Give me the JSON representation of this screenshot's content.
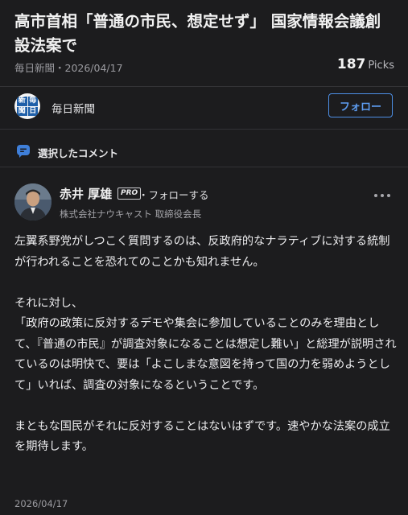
{
  "article": {
    "title": "高市首相「普通の市民、想定せず」 国家情報会議創設法案で",
    "source_date": "毎日新聞・2026/04/17",
    "picks_count": "187",
    "picks_label": "Picks"
  },
  "publisher": {
    "name": "毎日新聞",
    "logo_chars": [
      "新",
      "毎",
      "聞",
      "日"
    ],
    "follow_label": "フォロー"
  },
  "section": {
    "label": "選択したコメント",
    "icon": "comment-bubble-icon"
  },
  "comment": {
    "author_name": "赤井 厚雄",
    "badge": "PRO",
    "follow_label": "・フォローする",
    "author_title": "株式会社ナウキャスト 取締役会長",
    "paragraphs": [
      "左翼系野党がしつこく質問するのは、反政府的なナラティブに対する統制が行われることを恐れてのことかも知れません。",
      "",
      "それに対し、",
      "「政府の政策に反対するデモや集会に参加していることのみを理由として、『普通の市民』が調査対象になることは想定し難い」と総理が説明されているのは明快で、要は「よこしまな意図を持って国の力を弱めようとして」いれば、調査の対象になるということです。",
      "",
      "まともな国民がそれに反対することはないはずです。速やかな法案の成立を期待します。"
    ],
    "date": "2026/04/17"
  },
  "colors": {
    "background": "#1c1c1e",
    "accent": "#5d9cf0",
    "comment_icon": "#3f7fd9"
  }
}
